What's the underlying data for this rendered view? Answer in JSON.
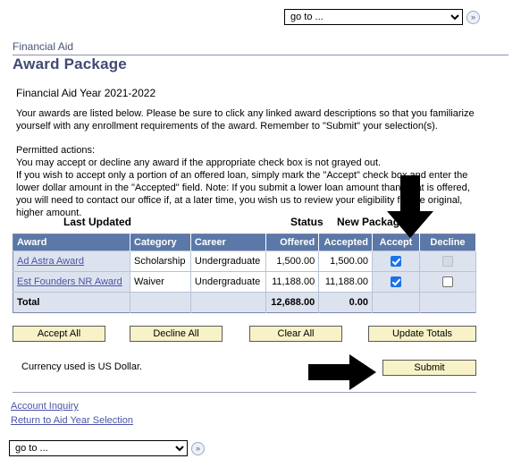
{
  "topbar": {
    "goto_value": "go to ...",
    "go_button_label": "»"
  },
  "header": {
    "breadcrumb": "Financial Aid",
    "page_title": "Award Package",
    "aid_year": "Financial Aid Year 2021-2022"
  },
  "instructions": {
    "para1": "Your awards are listed below. Please be sure to click any linked award descriptions so that you familiarize yourself with any enrollment requirements of the award. Remember to \"Submit\" your selection(s).",
    "permitted_heading": "Permitted actions:",
    "para2": "You may accept or decline any award if the appropriate check box is not grayed out.",
    "para3": "If you wish to accept only a portion of an offered loan, simply mark the \"Accept\" check box and enter the lower dollar amount in the \"Accepted\" field. Note: If  you submit a lower loan amount than what is offered, you will need to contact our office if, at a later time,  you wish us to review your eligibility for the original, higher amount."
  },
  "summary_labels": {
    "last_updated": "Last Updated",
    "status": "Status",
    "new_package": "New Package"
  },
  "table": {
    "columns": [
      "Award",
      "Category",
      "Career",
      "Offered",
      "Accepted",
      "Accept",
      "Decline"
    ],
    "rows": [
      {
        "award": "Ad Astra Award",
        "category": "Scholarship",
        "career": "Undergraduate",
        "offered": "1,500.00",
        "accepted": "1,500.00",
        "accept_checked": true,
        "decline_checked": false,
        "decline_disabled": true
      },
      {
        "award": "Est Founders NR Award",
        "category": "Waiver",
        "career": "Undergraduate",
        "offered": "11,188.00",
        "accepted": "11,188.00",
        "accept_checked": true,
        "decline_checked": false,
        "decline_disabled": false
      }
    ],
    "total": {
      "label": "Total",
      "offered": "12,688.00",
      "accepted": "0.00"
    }
  },
  "buttons": {
    "accept_all": "Accept All",
    "decline_all": "Decline All",
    "clear_all": "Clear All",
    "update_totals": "Update Totals",
    "submit": "Submit"
  },
  "currency_note": "Currency used is US Dollar.",
  "footer": {
    "account_inquiry": "Account Inquiry",
    "return_aid_year": "Return to Aid Year Selection",
    "goto_value": "go to ...",
    "go_button_label": "»"
  },
  "colors": {
    "table_header_bg": "#5b78a8",
    "row_accent_bg": "#dde3ee",
    "button_bg": "#f8f2c8",
    "link": "#4a54a8",
    "title": "#414a73",
    "checkbox_checked": "#1a73e8"
  }
}
